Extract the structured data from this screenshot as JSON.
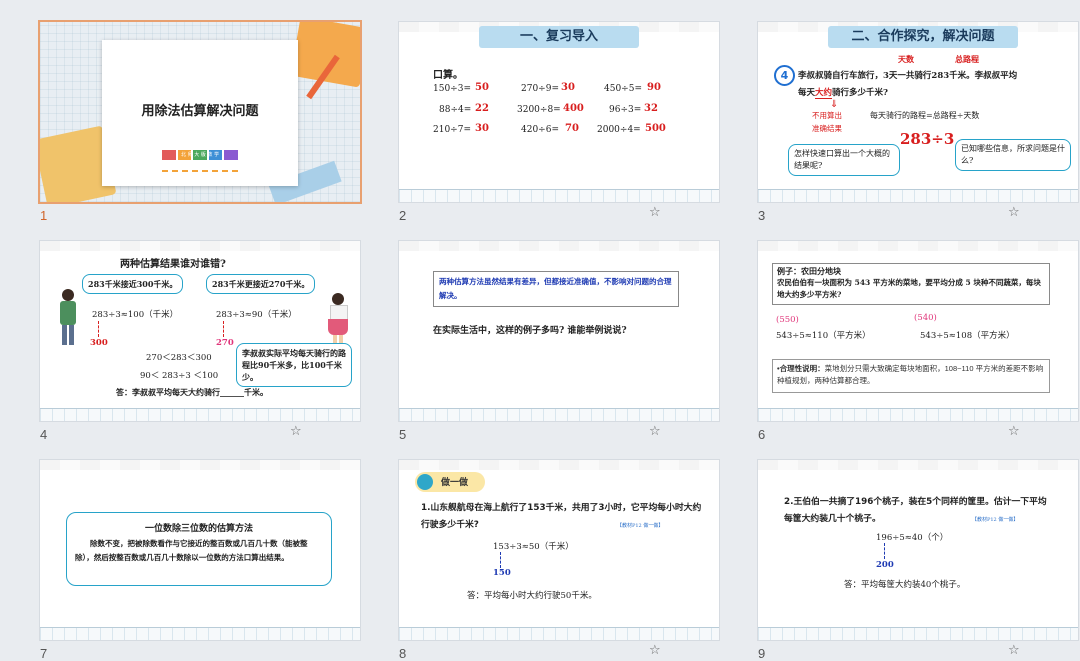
{
  "slides": [
    {
      "num": "1",
      "title": "用除法估算解决问题",
      "subtitle": "北 师 大 版 数 学"
    },
    {
      "num": "2",
      "banner": "一、复习导入",
      "intro": "口算。",
      "rows": [
        [
          {
            "q": "150÷3=",
            "a": "50"
          },
          {
            "q": "270÷9=",
            "a": "30"
          },
          {
            "q": "450÷5=",
            "a": "90"
          }
        ],
        [
          {
            "q": "88÷4=",
            "a": "22"
          },
          {
            "q": "3200÷8=",
            "a": "400"
          },
          {
            "q": "96÷3=",
            "a": "32"
          }
        ],
        [
          {
            "q": "210÷7=",
            "a": "30"
          },
          {
            "q": "420÷6=",
            "a": "70"
          },
          {
            "q": "2000÷4=",
            "a": "500"
          }
        ]
      ]
    },
    {
      "num": "3",
      "banner": "二、合作探究，解决问题",
      "label_days": "天数",
      "label_total": "总路程",
      "qnum": "4",
      "text1": "李叔叔骑自行车旅行，3天一共骑行283千米。李叔叔平均",
      "text2_pre": "每天",
      "text2_key": "大约",
      "text2_post": "骑行多少千米?",
      "note1": "不用算出",
      "note2": "准确结果",
      "formula": "每天骑行的路程=总路程÷天数",
      "expr": "283÷3",
      "bubble_left": "怎样快速口算出一个大概的结果呢?",
      "bubble_right": "已知哪些信息，所求问题是什么?"
    },
    {
      "num": "4",
      "title": "两种估算结果谁对谁错?",
      "left_claim": "283千米接近300千米。",
      "right_claim": "283千米更接近270千米。",
      "left_eq": "283÷3≈100（千米）",
      "left_approx": "300",
      "right_eq": "283÷3≈90（千米）",
      "right_approx": "270",
      "ineq1": "270＜283＜300",
      "ineq2": "90＜ 283÷3 ＜100",
      "bubble": "李叔叔实际平均每天骑行的路程比90千米多，比100千米少。",
      "answer": "答：李叔叔平均每天大约骑行______千米。"
    },
    {
      "num": "5",
      "box_text": "两种估算方法虽然结果有差异，但都接近准确值，不影响对问题的合理解决。",
      "question": "在实际生活中，这样的例子多吗? 谁能举例说说?"
    },
    {
      "num": "6",
      "heading": "例子：农田分地块",
      "body": "农民伯伯有一块面积为 543 平方米的菜地，要平均分成 5 块种不同蔬菜，每块地大约多少平方米?",
      "left_approx": "(550)",
      "right_approx": "(540)",
      "left_eq": "543÷5≈110（平方米）",
      "right_eq": "543÷5≈108（平方米）",
      "note_label": "•合理性说明：",
      "note": "菜地划分只需大致确定每块地面积，108~110 平方米的差距不影响种植规划，两种估算都合理。"
    },
    {
      "num": "7",
      "box_title": "一位数除三位数的估算方法",
      "box_body": "除数不变，把被除数看作与它接近的整百数或几百几十数（能被整除），然后按整百数或几百几十数除以一位数的方法口算出结果。"
    },
    {
      "num": "8",
      "badge": "做一做",
      "problem": "1.山东舰航母在海上航行了153千米，共用了3小时，它平均每小时大约行驶多少千米?",
      "ref": "【教材P12 做一做】",
      "eq": "153÷3≈50（千米）",
      "approx": "150",
      "answer": "答：平均每小时大约行驶50千米。"
    },
    {
      "num": "9",
      "problem": "2.王伯伯一共摘了196个桃子，装在5个同样的筐里。估计一下平均每筐大约装几十个桃子。",
      "ref": "【教材P12 做一做】",
      "eq": "196÷5≈40（个）",
      "approx": "200",
      "answer": "答：平均每筐大约装40个桃子。"
    }
  ],
  "colors": {
    "accent_red": "#d81e1e",
    "accent_blue": "#27a3c9",
    "selected_border": "#e8a070"
  },
  "icons": {
    "star": "star-icon"
  }
}
